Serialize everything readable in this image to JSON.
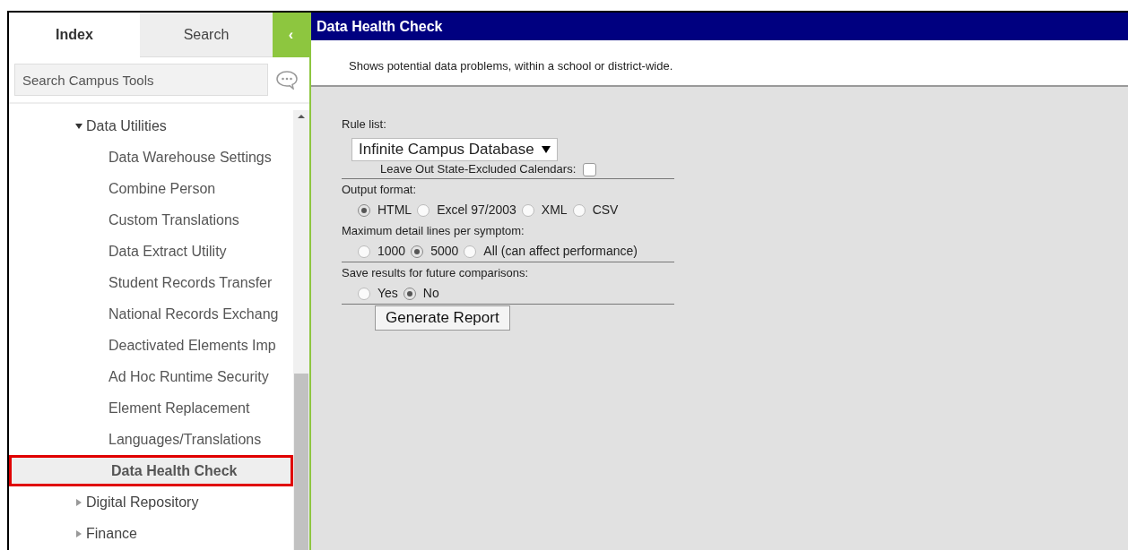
{
  "sidebar": {
    "tabs": [
      {
        "label": "Index",
        "selected": true
      },
      {
        "label": "Search",
        "selected": false
      }
    ],
    "collapse_button": "‹",
    "search": {
      "placeholder": "Search Campus Tools"
    },
    "tree": [
      {
        "label": "Data Utilities",
        "expanded": true,
        "selected": false,
        "children": [
          {
            "label": "Data Warehouse Settings",
            "selected": false
          },
          {
            "label": "Combine Person",
            "selected": false
          },
          {
            "label": "Custom Translations",
            "selected": false
          },
          {
            "label": "Data Extract Utility",
            "selected": false
          },
          {
            "label": "Student Records Transfer",
            "selected": false
          },
          {
            "label": "National Records Exchang",
            "selected": false
          },
          {
            "label": "Deactivated Elements Imp",
            "selected": false
          },
          {
            "label": "Ad Hoc Runtime Security",
            "selected": false
          },
          {
            "label": "Element Replacement",
            "selected": false
          },
          {
            "label": "Languages/Translations",
            "selected": false
          },
          {
            "label": "Data Health Check",
            "selected": true
          }
        ]
      },
      {
        "label": "Digital Repository",
        "expanded": false,
        "selected": false
      },
      {
        "label": "Finance",
        "expanded": false,
        "selected": false
      }
    ]
  },
  "main": {
    "title": "Data Health Check",
    "description": "Shows potential data problems, within a school or district-wide.",
    "rule_list": {
      "label": "Rule list:",
      "value": "Infinite Campus Database"
    },
    "exclude": {
      "label": "Leave Out State-Excluded Calendars:",
      "checked": false
    },
    "groups": [
      {
        "label": "Output format:",
        "options": [
          {
            "label": "HTML",
            "selected": true
          },
          {
            "label": "Excel 97/2003",
            "selected": false
          },
          {
            "label": "XML",
            "selected": false
          },
          {
            "label": "CSV",
            "selected": false
          }
        ]
      },
      {
        "label": "Maximum detail lines per symptom:",
        "options": [
          {
            "label": "1000",
            "selected": false
          },
          {
            "label": "5000",
            "selected": true
          },
          {
            "label": "All (can affect performance)",
            "selected": false
          }
        ]
      },
      {
        "label": "Save results for future comparisons:",
        "options": [
          {
            "label": "Yes",
            "selected": false
          },
          {
            "label": "No",
            "selected": true
          }
        ]
      }
    ],
    "button": "Generate Report"
  }
}
